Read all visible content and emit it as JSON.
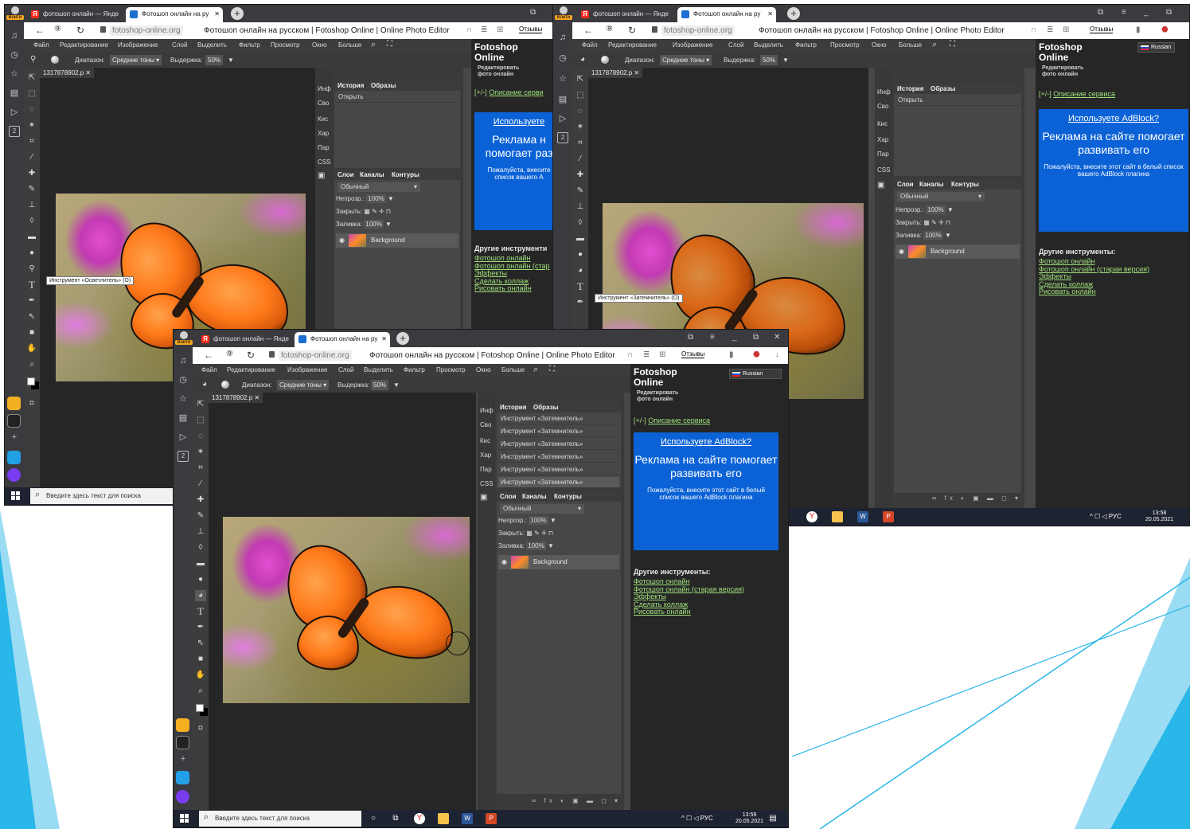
{
  "colors": {
    "accent_triangle": "#29b6e8",
    "adblock_box": "#0b62d6",
    "link_green": "#9fe07a"
  },
  "browser": {
    "login_label": "Войти",
    "tab_yandex": "фотошоп онлайн — Янде",
    "tab_photoshop": "Фотошоп онлайн на ру",
    "url": "fotoshop-online.org",
    "page_title": "Фотошоп онлайн на русском | Fotoshop Online | Online Photo Editor",
    "reviews": "Отзывы"
  },
  "app": {
    "menu": [
      "Файл",
      "Редактирование",
      "Изображение",
      "Слой",
      "Выделить",
      "Фильтр",
      "Просмотр",
      "Окно",
      "Больше"
    ],
    "options": {
      "range_label": "Диапазон:",
      "range_value": "Средние тоны",
      "exposure_label": "Выдержка:",
      "exposure_value": "50%"
    },
    "document_tab": "1317878902.p",
    "panel_tabs": [
      "Инф",
      "Сво",
      "Кис",
      "Хар",
      "Пар",
      "CSS"
    ],
    "history_tabs": [
      "История",
      "Образы"
    ],
    "layers_tabs": [
      "Слои",
      "Каналы",
      "Контуры"
    ],
    "blend_mode": "Обычный",
    "opacity_label": "Непрозр.:",
    "opacity_value": "100%",
    "lock_label": "Закрыть:",
    "fill_label": "Заливка:",
    "fill_value": "100%",
    "layer_name": "Background"
  },
  "win1": {
    "history": [
      "Открыть"
    ],
    "tooltip": "Инструмент «Осветлитель» (O)"
  },
  "win2": {
    "history": [
      "Открыть"
    ],
    "tooltip": "Инструмент «Затемнитель» (O)",
    "time": "13:58",
    "date": "20.05.2021"
  },
  "win3": {
    "history": [
      "Инструмент «Затемнитель»",
      "Инструмент «Затемнитель»",
      "Инструмент «Затемнитель»",
      "Инструмент «Затемнитель»",
      "Инструмент «Затемнитель»",
      "Инструмент «Затемнитель»"
    ],
    "time": "13:59",
    "date": "20.05.2021"
  },
  "sidebar": {
    "brand": "Fotoshop",
    "brand2": "Online",
    "sub1": "Редактировать",
    "sub2": "фото онлайн",
    "language": "Russian",
    "description_prefix": "[+/-]",
    "description_link": "Описание сервиса",
    "description_link_cut": "Описание серви",
    "ad_title": "Используете AdBlock?",
    "ad_title_cut": "Используете",
    "ad_headline": "Реклама на сайте помогает развивать его",
    "ad_headline_cut": "Реклама н помогает раз",
    "ad_body": "Пожалуйста, внесите этот сайт в белый список вашего AdBlock плагина",
    "ad_body_cut": "Пожалуйста, внесите список вашего А",
    "other_tools": "Другие инструменты:",
    "other_tools_cut": "Другие инструменти",
    "links": [
      "Фотошоп онлайн",
      "Фотошоп онлайн (старая версия)",
      "Эффекты",
      "Сделать коллаж",
      "Рисовать онлайн"
    ],
    "link2_cut": "Фотошоп онлайн (стар"
  },
  "taskbar": {
    "search_placeholder": "Введите здесь текст для поиска",
    "lang": "РУС"
  }
}
